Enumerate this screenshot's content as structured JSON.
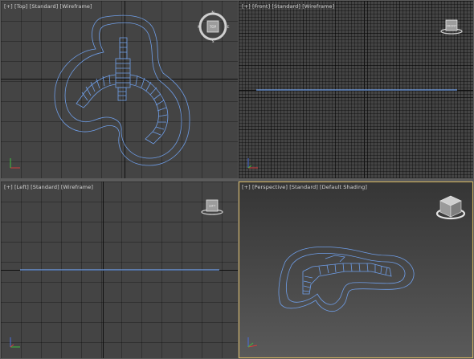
{
  "app": {
    "accent": "#d8b862",
    "wire_color": "#6f9ee8",
    "viewports": [
      {
        "id": "top",
        "menu": "[+]",
        "view": "[Top]",
        "shading_style": "[Standard]",
        "shading": "[Wireframe]",
        "active": false
      },
      {
        "id": "front",
        "menu": "[+]",
        "view": "[Front]",
        "shading_style": "[Standard]",
        "shading": "[Wireframe]",
        "active": false
      },
      {
        "id": "left",
        "menu": "[+]",
        "view": "[Left]",
        "shading_style": "[Standard]",
        "shading": "[Wireframe]",
        "active": false
      },
      {
        "id": "perspective",
        "menu": "[+]",
        "view": "[Perspective]",
        "shading_style": "[Standard]",
        "shading": "[Default Shading]",
        "active": true
      }
    ],
    "viewcube": {
      "compass": {
        "n": "N",
        "e": "E",
        "s": "S",
        "w": "W"
      },
      "top_face": "TOP",
      "front_face": "FRONT",
      "left_face": "LEFT"
    },
    "icons": [
      "viewcube-icon",
      "compass-ring-icon",
      "world-axis-icon"
    ]
  }
}
